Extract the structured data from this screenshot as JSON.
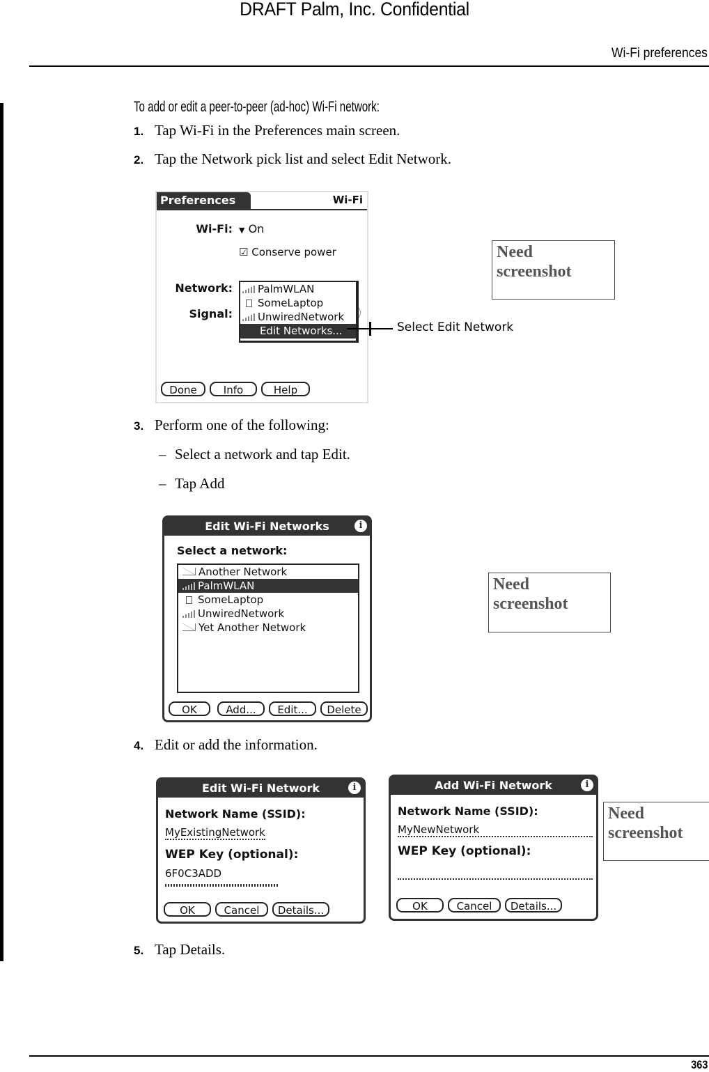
{
  "header": {
    "watermark": "DRAFT   Palm, Inc. Confidential",
    "running_head": "Wi-Fi preferences"
  },
  "footer": {
    "page_number": "363"
  },
  "procedure": {
    "heading": "To add or edit a peer-to-peer (ad-hoc) Wi-Fi network:",
    "steps": [
      {
        "num": "1.",
        "text": "Tap Wi-Fi in the Preferences main screen."
      },
      {
        "num": "2.",
        "text": "Tap the Network pick list and select Edit Network."
      },
      {
        "num": "3.",
        "text": "Perform one of the following:"
      },
      {
        "num": "4.",
        "text": "Edit or add the information."
      },
      {
        "num": "5.",
        "text": "Tap Details."
      }
    ],
    "step3_options": [
      {
        "bullet": "–",
        "text": "Select a network and tap Edit."
      },
      {
        "bullet": "–",
        "text": "Tap Add"
      }
    ]
  },
  "screens": {
    "preferences": {
      "title": "Preferences",
      "panel": "Wi-Fi",
      "wifi_label": "Wi-Fi:",
      "wifi_value": "On",
      "conserve_power": {
        "label": "Conserve power",
        "checked": true
      },
      "network_label": "Network:",
      "signal_label": "Signal:",
      "network_list": [
        {
          "name": "PalmWLAN",
          "icon": "signal-icon"
        },
        {
          "name": "SomeLaptop",
          "icon": "laptop-icon"
        },
        {
          "name": "UnwiredNetwork",
          "icon": "signal-icon"
        }
      ],
      "edit_networks_item": "Edit Networks...",
      "buttons": [
        "Done",
        "Info",
        "Help"
      ],
      "callout": "Select Edit Network"
    },
    "edit_networks": {
      "title": "Edit Wi-Fi Networks",
      "prompt": "Select a network:",
      "networks": [
        {
          "name": "Another Network",
          "icon": "adhoc-icon",
          "selected": false
        },
        {
          "name": "PalmWLAN",
          "icon": "signal-icon",
          "selected": true
        },
        {
          "name": "SomeLaptop",
          "icon": "laptop-icon",
          "selected": false
        },
        {
          "name": "UnwiredNetwork",
          "icon": "signal-icon",
          "selected": false
        },
        {
          "name": "Yet Another Network",
          "icon": "adhoc-icon",
          "selected": false
        }
      ],
      "buttons": [
        "OK",
        "Add...",
        "Edit...",
        "Delete"
      ]
    },
    "edit_network": {
      "title": "Edit Wi-Fi Network",
      "ssid_label": "Network Name (SSID):",
      "ssid_value": "MyExistingNetwork",
      "wep_label": "WEP Key (optional):",
      "wep_value": "6F0C3ADD",
      "buttons": [
        "OK",
        "Cancel",
        "Details..."
      ]
    },
    "add_network": {
      "title": "Add Wi-Fi Network",
      "ssid_label": "Network Name (SSID):",
      "ssid_value": "MyNewNetwork",
      "wep_label": "WEP Key (optional):",
      "wep_value": "",
      "buttons": [
        "OK",
        "Cancel",
        "Details..."
      ]
    }
  },
  "placeholders": {
    "need_screenshot": "Need screenshot"
  }
}
